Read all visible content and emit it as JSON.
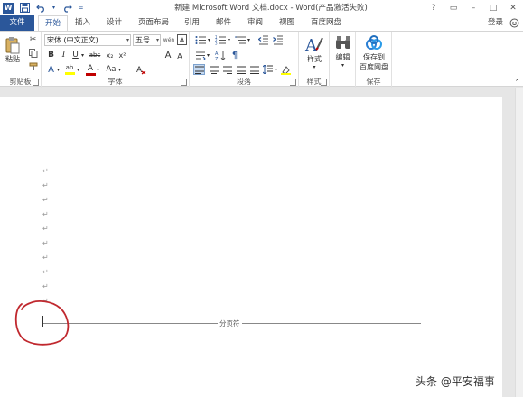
{
  "window": {
    "title": "新建 Microsoft Word 文档.docx - Word(产品激活失败)",
    "help": "?",
    "restore": "▭",
    "minimize": "–",
    "maximize": "□",
    "close": "✕"
  },
  "tabs": {
    "file": "文件",
    "home": "开始",
    "insert": "插入",
    "design": "设计",
    "layout": "页面布局",
    "references": "引用",
    "mailings": "邮件",
    "review": "审阅",
    "view": "视图",
    "baidu": "百度网盘",
    "signin": "登录"
  },
  "ribbon": {
    "clipboard": {
      "label": "剪贴板",
      "paste": "粘贴"
    },
    "font": {
      "label": "字体",
      "font_name": "宋体 (中文正文)",
      "font_size": "五号",
      "bold": "B",
      "italic": "I",
      "underline": "U",
      "strike": "abc",
      "subscript": "x₂",
      "superscript": "x²",
      "grow": "A",
      "shrink": "A",
      "case": "Aa",
      "clear": "A",
      "font_color": "A",
      "highlight": "ab",
      "text_effect": "A",
      "phonetic": "wén",
      "border": "A"
    },
    "paragraph": {
      "label": "段落"
    },
    "styles": {
      "label": "样式",
      "button": "样式"
    },
    "editing": {
      "button": "编辑"
    },
    "save": {
      "label": "保存",
      "button_line1": "保存到",
      "button_line2": "百度网盘"
    }
  },
  "document": {
    "paragraph_mark": "↵",
    "page_break_label": "分页符"
  },
  "watermark": "头条 @平安福事",
  "colors": {
    "accent": "#2b579a",
    "font_color_bar": "#c00000",
    "highlight_bar": "#ffff00",
    "annotation": "#c0282e"
  }
}
